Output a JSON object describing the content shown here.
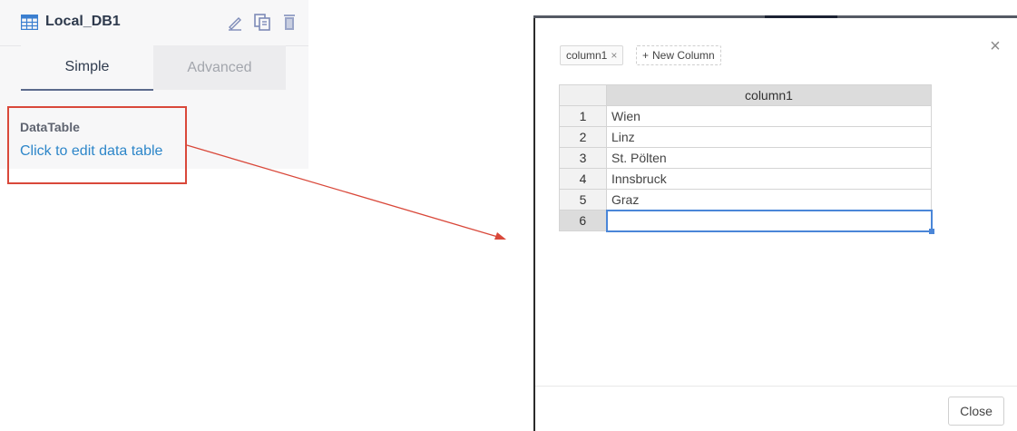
{
  "panel": {
    "title": "Local_DB1",
    "icons": [
      "table-icon",
      "pencil-icon",
      "copy-icon",
      "trash-icon"
    ],
    "tabs": [
      {
        "label": "Simple",
        "active": true
      },
      {
        "label": "Advanced",
        "active": false
      }
    ],
    "datatable_label": "DataTable",
    "edit_link": "Click to edit data table"
  },
  "modal": {
    "column_chip": "column1",
    "chip_remove": "×",
    "new_column_plus": "+",
    "new_column_label": "New Column",
    "close_x": "×",
    "grid": {
      "headers": [
        "column1"
      ],
      "rows": [
        {
          "num": "1",
          "value": "Wien"
        },
        {
          "num": "2",
          "value": "Linz"
        },
        {
          "num": "3",
          "value": "St. Pölten"
        },
        {
          "num": "4",
          "value": "Innsbruck"
        },
        {
          "num": "5",
          "value": "Graz"
        },
        {
          "num": "6",
          "value": ""
        }
      ]
    },
    "close_button": "Close"
  },
  "colors": {
    "accent": "#2d86c9",
    "annotation": "#d9483a",
    "selection": "#4a86d8"
  }
}
